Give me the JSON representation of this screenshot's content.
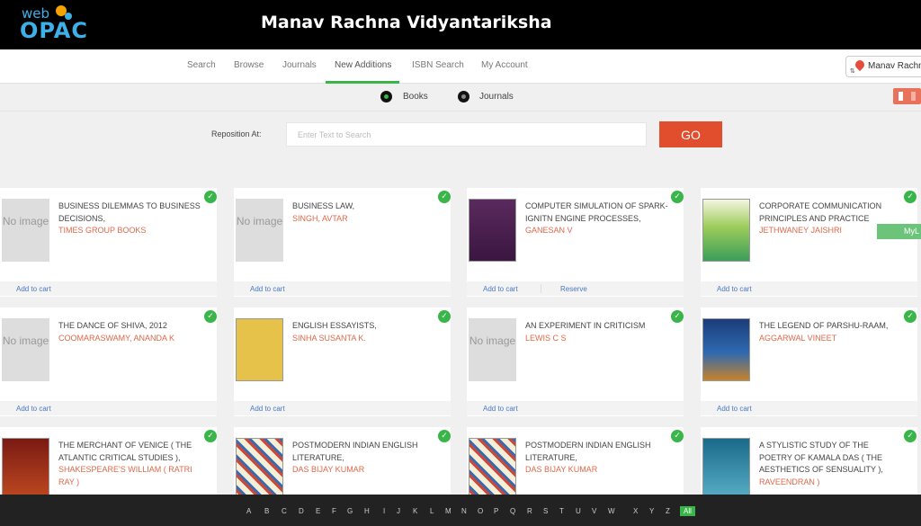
{
  "header": {
    "logo_web": "web",
    "logo_opac": "OPAC",
    "title": "Manav Rachna Vidyantariksha"
  },
  "nav": {
    "items": [
      "Search",
      "Browse",
      "Journals",
      "New Additions",
      "ISBN Search",
      "My Account"
    ],
    "active": "New Additions",
    "location": "Manav Rachna"
  },
  "type_filter": {
    "books": "Books",
    "journals": "Journals",
    "selected": "Books"
  },
  "reposition": {
    "label": "Reposition At:",
    "placeholder": "Enter Text to Search",
    "go_label": "GO"
  },
  "cards": [
    {
      "title": "BUSINESS DILEMMAS TO BUSINESS DECISIONS,",
      "author": "TIMES GROUP BOOKS",
      "cover": "none",
      "no_image": "No image",
      "cart": "Add to cart"
    },
    {
      "title": "BUSINESS LAW,",
      "author": "SINGH, AVTAR",
      "cover": "none",
      "no_image": "No image",
      "cart": "Add to cart"
    },
    {
      "title": "COMPUTER SIMULATION OF SPARK-IGNITN ENGINE PROCESSES,",
      "author": "GANESAN V",
      "cover": "purple",
      "cart": "Add to cart",
      "reserve": "Reserve"
    },
    {
      "title": "CORPORATE COMMUNICATION PRINCIPLES AND PRACTICE",
      "author": "JETHWANEY JAISHRI",
      "cover": "green",
      "cart": "Add to cart"
    },
    {
      "title": "THE DANCE OF SHIVA, 2012",
      "author": "COOMARASWAMY, ANANDA K",
      "cover": "none",
      "no_image": "No image",
      "cart": "Add to cart"
    },
    {
      "title": "ENGLISH ESSAYISTS,",
      "author": "SINHA SUSANTA K.",
      "cover": "yellow",
      "cart": "Add to cart"
    },
    {
      "title": "AN EXPERIMENT IN CRITICISM",
      "author": "LEWIS C S",
      "cover": "none",
      "no_image": "No image",
      "cart": "Add to cart"
    },
    {
      "title": "THE LEGEND OF PARSHU-RAAM,",
      "author": "AGGARWAL VINEET",
      "cover": "blue",
      "cart": "Add to cart"
    },
    {
      "title": "THE MERCHANT OF VENICE ( THE ATLANTIC CRITICAL STUDIES ),",
      "author": "SHAKESPEARE'S WILLIAM ( RATRI RAY )",
      "cover": "red"
    },
    {
      "title": "POSTMODERN INDIAN ENGLISH LITERATURE,",
      "author": "DAS BIJAY KUMAR",
      "cover": "pattern"
    },
    {
      "title": "POSTMODERN INDIAN ENGLISH LITERATURE,",
      "author": "DAS BIJAY KUMAR",
      "cover": "pattern"
    },
    {
      "title": "A STYLISTIC STUDY OF THE POETRY OF KAMALA DAS ( THE AESTHETICS OF SENSUALITY ),",
      "author": "RAVEENDRAN )",
      "cover": "teal"
    }
  ],
  "mylist_label": "MyL",
  "alphabet": [
    "A",
    "B",
    "C",
    "D",
    "E",
    "F",
    "G",
    "H",
    "I",
    "J",
    "K",
    "L",
    "M",
    "N",
    "O",
    "P",
    "Q",
    "R",
    "S",
    "T",
    "U",
    "V",
    "W",
    "X",
    "Y",
    "Z",
    "All"
  ],
  "colors": {
    "accent_green": "#39b54a",
    "go_red": "#e04e2e",
    "author_orange": "#e0684a",
    "link_blue": "#4a78c2"
  }
}
